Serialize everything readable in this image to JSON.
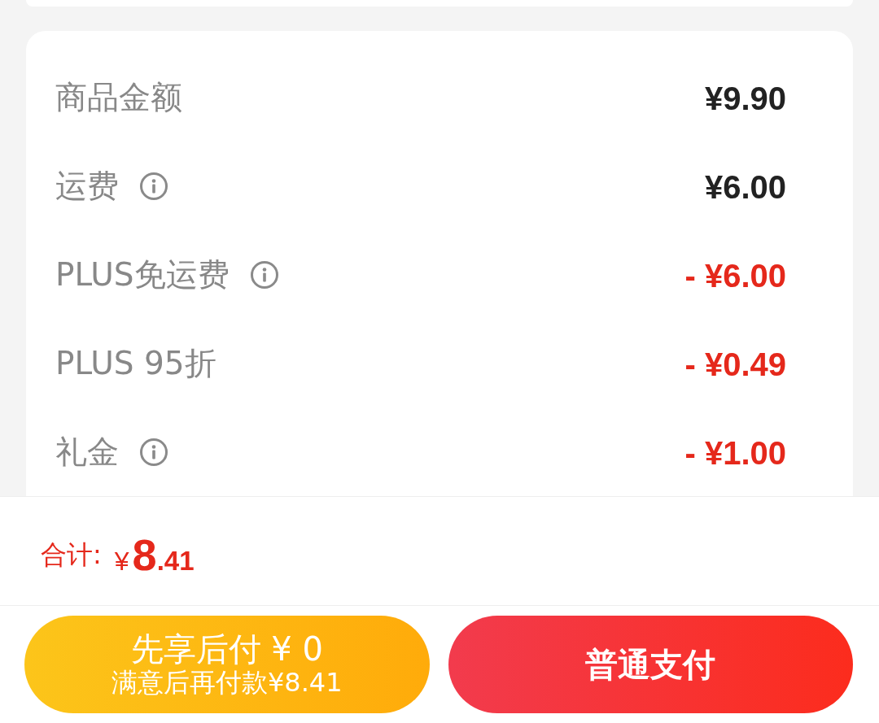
{
  "price_details": {
    "rows": [
      {
        "label": "商品金额",
        "info": false,
        "kind": "charge",
        "value": "¥9.90"
      },
      {
        "label": "运费",
        "info": true,
        "kind": "charge",
        "value": "¥6.00"
      },
      {
        "label": "PLUS免运费",
        "info": true,
        "kind": "discount",
        "value": "- ¥6.00"
      },
      {
        "label": "PLUS 95折",
        "info": false,
        "kind": "discount",
        "value": "- ¥0.49"
      },
      {
        "label": "礼金",
        "info": true,
        "kind": "discount",
        "value": "- ¥1.00"
      }
    ]
  },
  "total": {
    "label": "合计:",
    "currency": "¥",
    "integer": "8",
    "decimal": ".41"
  },
  "buttons": [
    {
      "kind": "pay_later",
      "title": "先享后付 ¥ 0",
      "subtitle": "满意后再付款¥8.41"
    },
    {
      "kind": "pay_now",
      "title": "普通支付"
    }
  ]
}
